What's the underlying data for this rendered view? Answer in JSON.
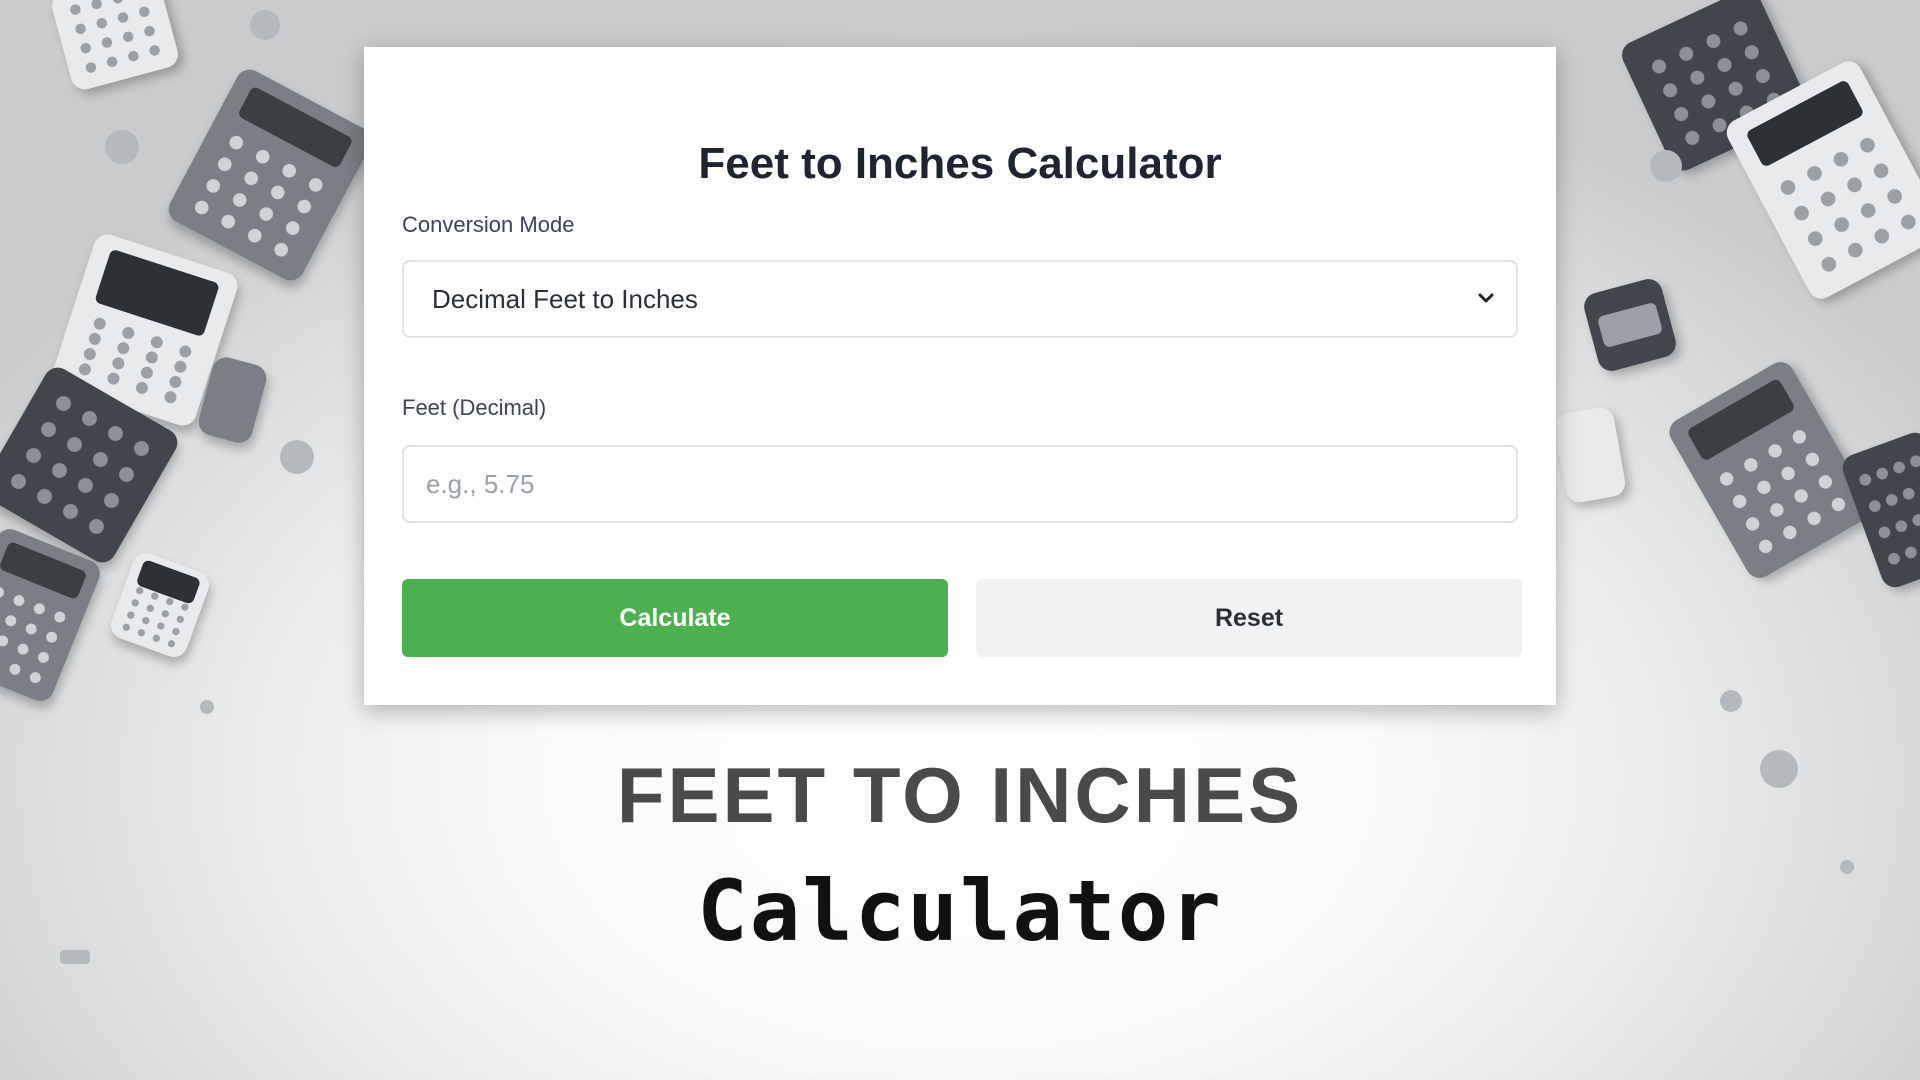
{
  "card": {
    "title": "Feet to Inches Calculator",
    "mode_label": "Conversion Mode",
    "mode_selected": "Decimal Feet to Inches",
    "feet_label": "Feet (Decimal)",
    "feet_placeholder": "e.g., 5.75",
    "feet_value": "",
    "calculate_label": "Calculate",
    "reset_label": "Reset"
  },
  "banner": {
    "line1": "FEET TO INCHES",
    "line2": "Calculator"
  },
  "colors": {
    "accent_green": "#4caf50",
    "reset_bg": "#f1f2f3",
    "title_text": "#1e2530"
  },
  "icons": {
    "select_indicator": "chevron-down-icon"
  }
}
